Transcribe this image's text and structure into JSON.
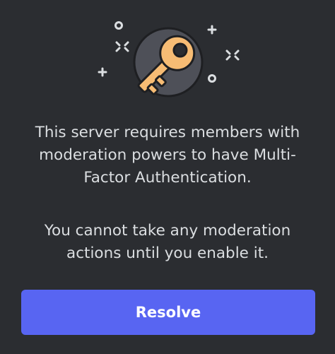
{
  "modal": {
    "illustration_icon": "key-icon",
    "message_line_1": "This server requires members with",
    "message_line_2": "moderation powers to have Multi-",
    "message_line_3": "Factor Authentication.",
    "message_line_4": "You cannot take any moderation",
    "message_line_5": "actions until you enable it.",
    "resolve_label": "Resolve"
  },
  "colors": {
    "background": "#2b2d31",
    "key_fill": "#f7bc74",
    "key_outline": "#1e1f22",
    "circle": "#4e5058",
    "sparkle": "#dbdee1",
    "button": "#5865f2",
    "text": "#dbdee1"
  }
}
